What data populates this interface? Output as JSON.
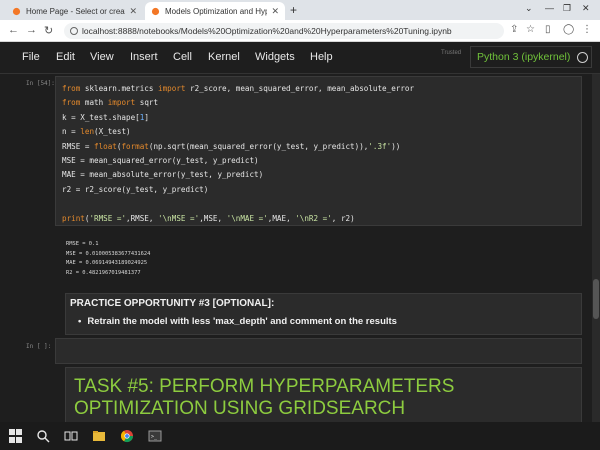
{
  "browser": {
    "tabs": [
      {
        "label": "Home Page - Select or create a n",
        "active": false
      },
      {
        "label": "Models Optimization and Hyper",
        "active": true
      }
    ],
    "url": "localhost:8888/notebooks/Models%20Optimization%20and%20Hyperparameters%20Tuning.ipynb"
  },
  "menubar": {
    "items": [
      "File",
      "Edit",
      "View",
      "Insert",
      "Cell",
      "Kernel",
      "Widgets",
      "Help"
    ],
    "trusted": "Trusted",
    "kernel": "Python 3 (ipykernel)"
  },
  "cells": {
    "code_prompt": "In [54]:",
    "code_lines": [
      "from sklearn.metrics import r2_score, mean_squared_error, mean_absolute_error",
      "from math import sqrt",
      "k = X_test.shape[1]",
      "n = len(X_test)",
      "RMSE = float(format(np.sqrt(mean_squared_error(y_test, y_predict)),'.3f'))",
      "MSE = mean_squared_error(y_test, y_predict)",
      "MAE = mean_absolute_error(y_test, y_predict)",
      "r2 = r2_score(y_test, y_predict)",
      "",
      "print('RMSE =',RMSE, '\\nMSE =',MSE, '\\nMAE =',MAE, '\\nR2 =', r2)"
    ],
    "output_lines": [
      "RMSE = 0.1",
      "MSE = 0.010005383677431624",
      "MAE = 0.06914943189024925",
      "R2 = 0.4821967019481377"
    ],
    "practice_title": "PRACTICE OPPORTUNITY #3 [OPTIONAL]:",
    "practice_bullet": "Retrain the model with less 'max_depth' and comment on the results",
    "empty_prompt": "In [ ]:",
    "task_heading": "TASK #5: PERFORM HYPERPARAMETERS OPTIMIZATION USING GRIDSEARCH"
  },
  "colors": {
    "keyword": "#e58a2c",
    "kernel_green": "#70c23a",
    "task_green": "#8dcc3f"
  }
}
